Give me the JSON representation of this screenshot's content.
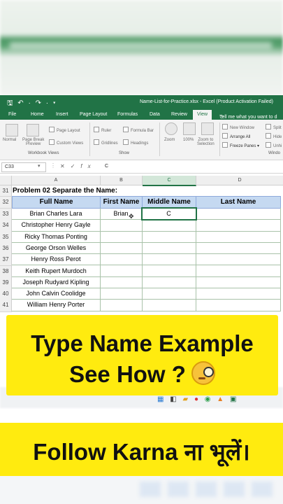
{
  "window": {
    "quick_access": "🖫 ↶ · ↷ · ▾",
    "title": "Name-List-for-Practice.xlsx - Excel (Product Activation Failed)"
  },
  "ribbon_tabs": [
    "File",
    "Home",
    "Insert",
    "Page Layout",
    "Formulas",
    "Data",
    "Review",
    "View"
  ],
  "active_tab": "View",
  "tell_me": "Tell me what you want to d",
  "ribbon": {
    "workbook_views": {
      "normal": "Normal",
      "page_break": "Page Break\nPreview",
      "page_layout": "Page Layout",
      "custom_views": "Custom Views",
      "label": "Workbook Views"
    },
    "show": {
      "ruler": "Ruler",
      "formula_bar": "Formula Bar",
      "gridlines": "Gridlines",
      "headings": "Headings",
      "label": "Show"
    },
    "zoom": {
      "zoom": "Zoom",
      "hundred": "100%",
      "zoom_to_selection": "Zoom to\nSelection"
    },
    "window": {
      "new_window": "New Window",
      "arrange_all": "Arrange All",
      "freeze_panes": "Freeze Panes",
      "split": "Split",
      "hide": "Hide",
      "unhide": "Unhi",
      "label": "Windo"
    }
  },
  "formula_bar": {
    "name_box": "C33",
    "value": "C"
  },
  "columns": [
    "A",
    "B",
    "C",
    "D"
  ],
  "selected_column": "C",
  "rows": {
    "row_numbers": [
      "31",
      "32",
      "33",
      "34",
      "35",
      "36",
      "37",
      "38",
      "39",
      "40",
      "41"
    ],
    "problem_title": "Problem 02 Separate the Name:",
    "headers": [
      "Full Name",
      "First Name",
      "Middle Name",
      "Last Name"
    ],
    "full_names": [
      "Brian Charles Lara",
      "Christopher Henry Gayle",
      "Ricky Thomas Ponting",
      "George Orson Welles",
      "Henry Ross Perot",
      "Keith Rupert Murdoch",
      "Joseph Rudyard Kipling",
      "John Calvin Coolidge",
      "William Henry Porter"
    ],
    "first_name_entry": "Brian",
    "middle_name_entry": "C"
  },
  "overlay": {
    "line1": "Type Name Example",
    "line2": "See How ?",
    "emoji": "face-with-monocle",
    "follow": "Follow Karna ना भूलें।"
  },
  "colors": {
    "excel_green": "#217346",
    "header_fill": "#c5d9f1",
    "overlay_yellow": "#ffeb0f"
  }
}
